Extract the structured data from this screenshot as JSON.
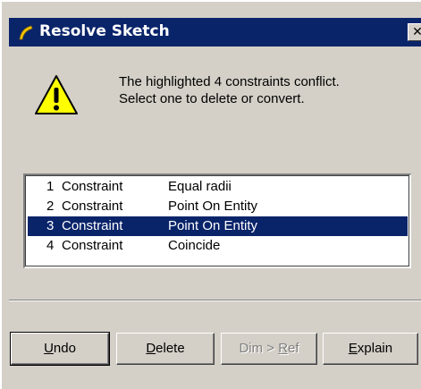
{
  "window": {
    "title": "Resolve Sketch",
    "close_glyph": "✕"
  },
  "message": {
    "line1": "The highlighted 4 constraints conflict.",
    "line2": "Select one to delete or convert."
  },
  "constraints": [
    {
      "num": "1",
      "type": "Constraint",
      "desc": "Equal radii",
      "selected": false
    },
    {
      "num": "2",
      "type": "Constraint",
      "desc": "Point On Entity",
      "selected": false
    },
    {
      "num": "3",
      "type": "Constraint",
      "desc": "Point On Entity",
      "selected": true
    },
    {
      "num": "4",
      "type": "Constraint",
      "desc": "Coincide",
      "selected": false
    }
  ],
  "buttons": {
    "undo": {
      "mn": "U",
      "rest": "ndo"
    },
    "delete": {
      "mn": "D",
      "rest": "elete"
    },
    "dimref": {
      "pre": "Dim > ",
      "mn": "R",
      "rest": "ef"
    },
    "explain": {
      "mn": "E",
      "rest": "xplain"
    }
  },
  "colors": {
    "titlebar": "#0a246a",
    "dialog_face": "#d4d0c8",
    "selection": "#0a246a",
    "warning_yellow": "#ffff00"
  },
  "icons": {
    "title": "sketch-icon",
    "warning": "warning-icon"
  }
}
